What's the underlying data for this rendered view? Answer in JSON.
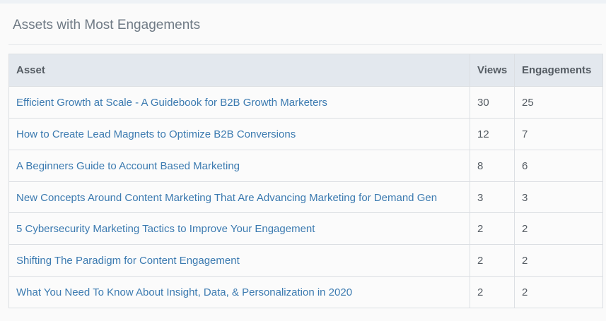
{
  "panel": {
    "title": "Assets with Most Engagements"
  },
  "table": {
    "headers": {
      "asset": "Asset",
      "views": "Views",
      "engagements": "Engagements"
    },
    "rows": [
      {
        "asset": "Efficient Growth at Scale - A Guidebook for B2B Growth Marketers",
        "views": "30",
        "engagements": "25"
      },
      {
        "asset": "How to Create Lead Magnets to Optimize B2B Conversions",
        "views": "12",
        "engagements": "7"
      },
      {
        "asset": "A Beginners Guide to Account Based Marketing",
        "views": "8",
        "engagements": "6"
      },
      {
        "asset": "New Concepts Around Content Marketing That Are Advancing Marketing for Demand Gen",
        "views": "3",
        "engagements": "3"
      },
      {
        "asset": "5 Cybersecurity Marketing Tactics to Improve Your Engagement",
        "views": "2",
        "engagements": "2"
      },
      {
        "asset": "Shifting The Paradigm for Content Engagement",
        "views": "2",
        "engagements": "2"
      },
      {
        "asset": "What You Need To Know About Insight, Data, & Personalization in 2020",
        "views": "2",
        "engagements": "2"
      }
    ]
  },
  "colors": {
    "link": "#3b7ab0",
    "header_bg": "#e3e8ee",
    "title": "#6f7a85"
  }
}
